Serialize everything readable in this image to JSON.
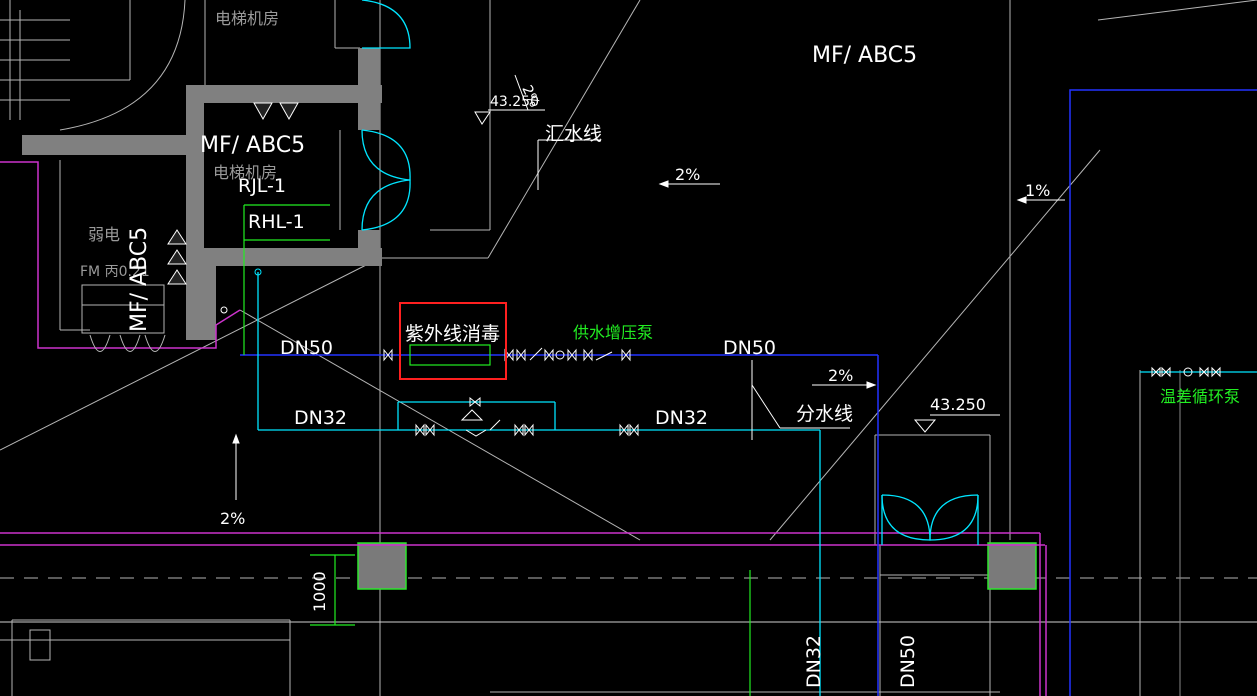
{
  "drawing": {
    "room_labels": {
      "elevator_room_top": "电梯机房",
      "elevator_room_mid": "电梯机房",
      "weak_current": "弱电",
      "fm_door": "FM 丙0.21"
    },
    "extinguisher_labels": {
      "top_right": "MF/ ABC5",
      "center_left": "MF/ ABC5",
      "vertical_left": "MF/ ABC5"
    },
    "pipe_ids": {
      "rjl": "RJL-1",
      "rhl": "RHL-1"
    },
    "elevations": {
      "top": "43.250",
      "right": "43.250"
    },
    "line_labels": {
      "collect_water": "汇水线",
      "divide_water": "分水线"
    },
    "slopes": {
      "center": "2%",
      "right": "1%",
      "mid_right": "2%",
      "lower_left": "2%",
      "top_rotated": "2%"
    },
    "pipe_sizes": {
      "dn50_left": "DN50",
      "dn50_right": "DN50",
      "dn32_left": "DN32",
      "dn32_right": "DN32",
      "dn32_vertical": "DN32",
      "dn50_vertical": "DN50"
    },
    "equipment": {
      "uv_disinfection": "紫外线消毒",
      "booster_pump": "供水增压泵",
      "temp_circ_pump": "温差循环泵"
    },
    "dimensions": {
      "dim_1000": "1000"
    },
    "colors": {
      "background": "#000000",
      "wall": "#808080",
      "pipe_cyan": "#00e5ff",
      "pipe_blue": "#2233ff",
      "purple": "#cc33cc",
      "green": "#22ee22",
      "highlight_red": "#ff2020"
    }
  }
}
